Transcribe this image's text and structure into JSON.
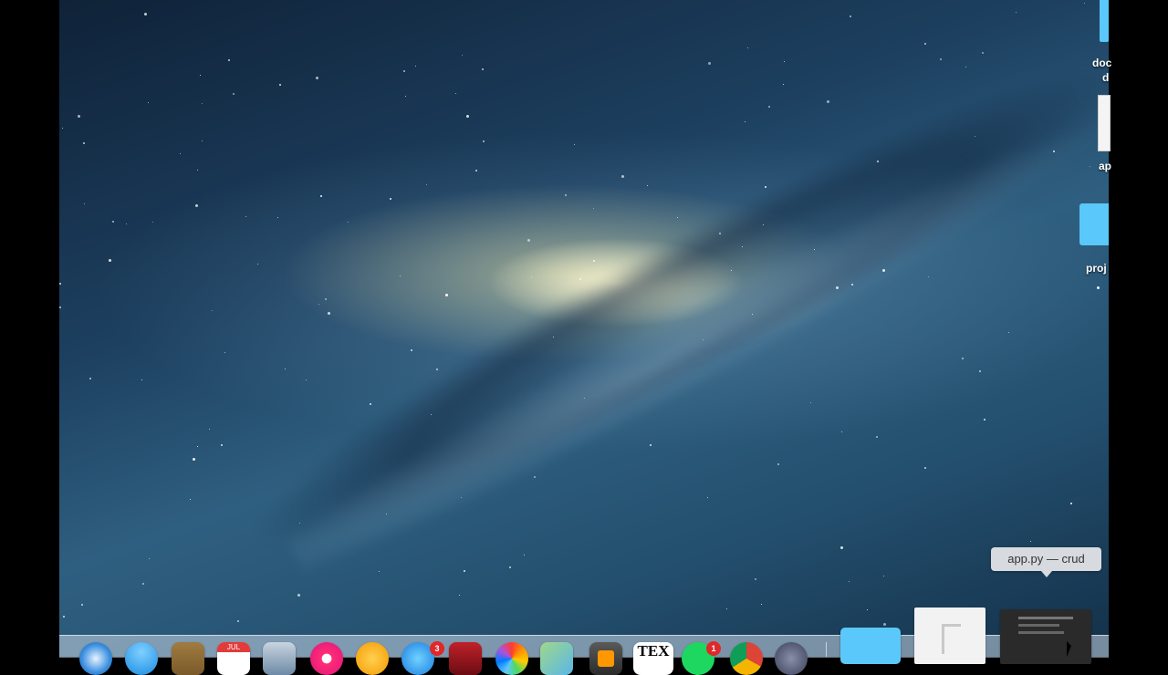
{
  "desktop": {
    "wallpaper": "galaxy",
    "icons": [
      {
        "name": "documents-folder",
        "label": "doc",
        "label2": "d"
      },
      {
        "name": "app-py-file",
        "label": "ap"
      },
      {
        "name": "projects-folder",
        "label": "proj"
      }
    ]
  },
  "tooltip": {
    "text": "app.py — crud"
  },
  "dock": {
    "apps": [
      {
        "name": "safari",
        "icon": "compass-icon"
      },
      {
        "name": "mail",
        "icon": "mail-icon"
      },
      {
        "name": "notes",
        "icon": "notes-icon"
      },
      {
        "name": "calendar",
        "icon": "calendar-icon",
        "text": "JUL"
      },
      {
        "name": "preview",
        "icon": "preview-icon"
      },
      {
        "name": "itunes",
        "icon": "music-icon"
      },
      {
        "name": "ibooks",
        "icon": "book-icon"
      },
      {
        "name": "app-store",
        "icon": "appstore-icon",
        "badge": "3"
      },
      {
        "name": "photo-booth",
        "icon": "photobooth-icon"
      },
      {
        "name": "photos",
        "icon": "photos-icon"
      },
      {
        "name": "maps",
        "icon": "maps-icon"
      },
      {
        "name": "sublime-text",
        "icon": "sublime-icon"
      },
      {
        "name": "tex",
        "icon": "tex-icon",
        "text": "TEX"
      },
      {
        "name": "spotify",
        "icon": "spotify-icon",
        "badge": "1"
      },
      {
        "name": "chrome",
        "icon": "chrome-icon"
      },
      {
        "name": "system",
        "icon": "gear-icon"
      }
    ],
    "stacks": [
      {
        "name": "documents-stack",
        "icon": "folder-icon"
      },
      {
        "name": "music-stack",
        "icon": "music-note-icon"
      },
      {
        "name": "terminal-window",
        "icon": "terminal-icon"
      }
    ]
  },
  "colors": {
    "badge": "#e0272a",
    "folder": "#5ac8fa"
  }
}
